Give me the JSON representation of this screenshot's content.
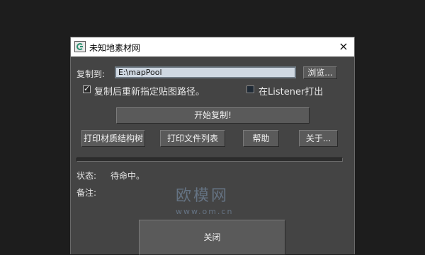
{
  "window": {
    "title": "未知地素材网",
    "close_label": "×"
  },
  "copy_to": {
    "label": "复制到:",
    "value": "E:\\mapPool",
    "browse_label": "浏览..."
  },
  "options": {
    "relink_label": "复制后重新指定贴图路径。",
    "relink_checked": true,
    "listener_label": "在Listener打出",
    "listener_checked": false
  },
  "buttons": {
    "start_copy": "开始复制!",
    "print_material_tree": "打印材质结构树",
    "print_file_list": "打印文件列表",
    "help": "帮助",
    "about": "关于...",
    "close": "关闭"
  },
  "progress": {
    "value": 0
  },
  "status": {
    "label": "状态:",
    "value": "待命中。"
  },
  "note": {
    "label": "备注:"
  },
  "watermark": {
    "cn": "欧模网",
    "url": "www.om.cn"
  },
  "colors": {
    "dialog_bg": "#444444",
    "titlebar_bg": "#ffffff",
    "input_bg": "#cfd8e2",
    "button_bg": "#5a5a5a",
    "watermark": "#6e7f93"
  }
}
